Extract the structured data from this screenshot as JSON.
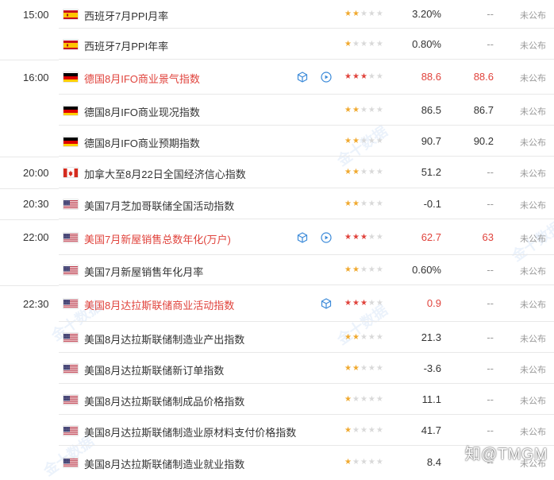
{
  "watermark": "金十数据",
  "brand": "知@TMGM",
  "prev_placeholder": "未公布",
  "rows": [
    {
      "time": "15:00",
      "flag": "es",
      "flag-name": "spain-flag-icon",
      "name": "西班牙7月PPI月率",
      "highlight": false,
      "stars": 2,
      "actual": "3.20%",
      "forecast": "--",
      "prev": "未公布",
      "icons": []
    },
    {
      "time": "",
      "flag": "es",
      "flag-name": "spain-flag-icon",
      "name": "西班牙7月PPI年率",
      "highlight": false,
      "stars": 1,
      "actual": "0.80%",
      "forecast": "--",
      "prev": "未公布",
      "icons": []
    },
    {
      "time": "16:00",
      "flag": "de",
      "flag-name": "germany-flag-icon",
      "name": "德国8月IFO商业景气指数",
      "highlight": true,
      "stars": 3,
      "actual": "88.6",
      "forecast": "88.6",
      "prev": "未公布",
      "icons": [
        "cube",
        "play"
      ]
    },
    {
      "time": "",
      "flag": "de",
      "flag-name": "germany-flag-icon",
      "name": "德国8月IFO商业现况指数",
      "highlight": false,
      "stars": 2,
      "actual": "86.5",
      "forecast": "86.7",
      "prev": "未公布",
      "icons": []
    },
    {
      "time": "",
      "flag": "de",
      "flag-name": "germany-flag-icon",
      "name": "德国8月IFO商业预期指数",
      "highlight": false,
      "stars": 2,
      "actual": "90.7",
      "forecast": "90.2",
      "prev": "未公布",
      "icons": []
    },
    {
      "time": "20:00",
      "flag": "ca",
      "flag-name": "canada-flag-icon",
      "name": "加拿大至8月22日全国经济信心指数",
      "highlight": false,
      "stars": 2,
      "actual": "51.2",
      "forecast": "--",
      "prev": "未公布",
      "icons": []
    },
    {
      "time": "20:30",
      "flag": "us",
      "flag-name": "usa-flag-icon",
      "name": "美国7月芝加哥联储全国活动指数",
      "highlight": false,
      "stars": 2,
      "actual": "-0.1",
      "forecast": "--",
      "prev": "未公布",
      "icons": []
    },
    {
      "time": "22:00",
      "flag": "us",
      "flag-name": "usa-flag-icon",
      "name": "美国7月新屋销售总数年化(万户)",
      "highlight": true,
      "stars": 3,
      "actual": "62.7",
      "forecast": "63",
      "prev": "未公布",
      "icons": [
        "cube",
        "play"
      ]
    },
    {
      "time": "",
      "flag": "us",
      "flag-name": "usa-flag-icon",
      "name": "美国7月新屋销售年化月率",
      "highlight": false,
      "stars": 2,
      "actual": "0.60%",
      "forecast": "--",
      "prev": "未公布",
      "icons": []
    },
    {
      "time": "22:30",
      "flag": "us",
      "flag-name": "usa-flag-icon",
      "name": "美国8月达拉斯联储商业活动指数",
      "highlight": true,
      "stars": 3,
      "actual": "0.9",
      "forecast": "--",
      "prev": "未公布",
      "icons": [
        "cube"
      ]
    },
    {
      "time": "",
      "flag": "us",
      "flag-name": "usa-flag-icon",
      "name": "美国8月达拉斯联储制造业产出指数",
      "highlight": false,
      "stars": 2,
      "actual": "21.3",
      "forecast": "--",
      "prev": "未公布",
      "icons": []
    },
    {
      "time": "",
      "flag": "us",
      "flag-name": "usa-flag-icon",
      "name": "美国8月达拉斯联储新订单指数",
      "highlight": false,
      "stars": 2,
      "actual": "-3.6",
      "forecast": "--",
      "prev": "未公布",
      "icons": []
    },
    {
      "time": "",
      "flag": "us",
      "flag-name": "usa-flag-icon",
      "name": "美国8月达拉斯联储制成品价格指数",
      "highlight": false,
      "stars": 1,
      "actual": "11.1",
      "forecast": "--",
      "prev": "未公布",
      "icons": []
    },
    {
      "time": "",
      "flag": "us",
      "flag-name": "usa-flag-icon",
      "name": "美国8月达拉斯联储制造业原材料支付价格指数",
      "highlight": false,
      "stars": 1,
      "actual": "41.7",
      "forecast": "--",
      "prev": "未公布",
      "icons": []
    },
    {
      "time": "",
      "flag": "us",
      "flag-name": "usa-flag-icon",
      "name": "美国8月达拉斯联储制造业就业指数",
      "highlight": false,
      "stars": 1,
      "actual": "8.4",
      "forecast": "--",
      "prev": "未公布",
      "icons": []
    }
  ],
  "colors": {
    "highlight": "#e0433c",
    "star": "#f0a92f",
    "star_off": "#d9d9d9",
    "muted": "#999999"
  }
}
